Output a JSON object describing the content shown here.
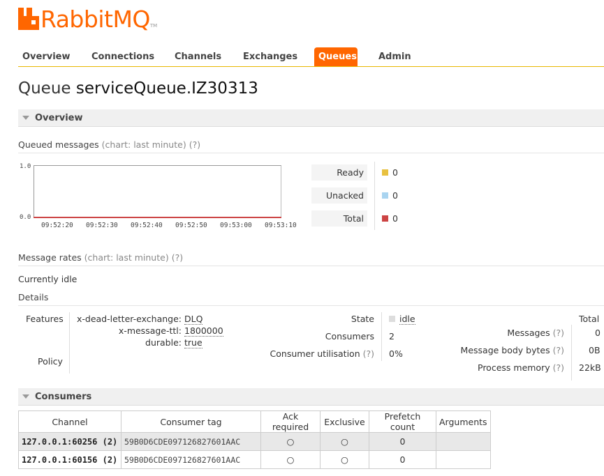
{
  "logo": {
    "text_rabbit": "Rabbit",
    "text_mq": "MQ",
    "tm": "TM"
  },
  "nav": {
    "tabs": [
      {
        "label": "Overview"
      },
      {
        "label": "Connections"
      },
      {
        "label": "Channels"
      },
      {
        "label": "Exchanges"
      },
      {
        "label": "Queues",
        "active": true
      },
      {
        "label": "Admin"
      }
    ]
  },
  "page": {
    "title_prefix": "Queue",
    "queue_name": "serviceQueue.IZ30313"
  },
  "overview": {
    "heading": "Overview",
    "queued_messages": {
      "label": "Queued messages",
      "chart_note": "(chart: last minute)",
      "help": "(?)"
    },
    "chart": {
      "y_max": "1.0",
      "y_min": "0.0",
      "x_ticks": [
        "09:52:20",
        "09:52:30",
        "09:52:40",
        "09:52:50",
        "09:53:00",
        "09:53:10"
      ]
    },
    "legend": [
      {
        "label": "Ready",
        "value": "0",
        "color": "#e8c140"
      },
      {
        "label": "Unacked",
        "value": "0",
        "color": "#a9d4f0"
      },
      {
        "label": "Total",
        "value": "0",
        "color": "#c44"
      }
    ],
    "message_rates": {
      "label": "Message rates",
      "chart_note": "(chart: last minute)",
      "help": "(?)"
    },
    "currently_idle": "Currently idle",
    "details_heading": "Details"
  },
  "details": {
    "features_label": "Features",
    "policy_label": "Policy",
    "features": [
      {
        "key": "x-dead-letter-exchange:",
        "value": "DLQ"
      },
      {
        "key": "x-message-ttl:",
        "value": "1800000"
      },
      {
        "key": "durable:",
        "value": "true"
      }
    ],
    "state_label": "State",
    "state_value": "idle",
    "consumers_label": "Consumers",
    "consumers_value": "2",
    "utilisation_label": "Consumer utilisation",
    "utilisation_help": "(?)",
    "utilisation_value": "0%",
    "total_label": "Total",
    "messages_label": "Messages",
    "messages_help": "(?)",
    "messages_value": "0",
    "body_bytes_label": "Message body bytes",
    "body_bytes_help": "(?)",
    "body_bytes_value": "0B",
    "process_memory_label": "Process memory",
    "process_memory_help": "(?)",
    "process_memory_value": "22kB"
  },
  "consumers": {
    "heading": "Consumers",
    "columns": [
      "Channel",
      "Consumer tag",
      "Ack required",
      "Exclusive",
      "Prefetch count",
      "Arguments"
    ],
    "rows": [
      {
        "channel": "127.0.0.1:60256 (2)",
        "tag": "59B0D6CDE097126827601AAC",
        "ack": "○",
        "exclusive": "○",
        "prefetch": "0",
        "arguments": ""
      },
      {
        "channel": "127.0.0.1:60156 (2)",
        "tag": "59B0D6CDE097126827601AAC",
        "ack": "○",
        "exclusive": "○",
        "prefetch": "0",
        "arguments": ""
      }
    ]
  }
}
